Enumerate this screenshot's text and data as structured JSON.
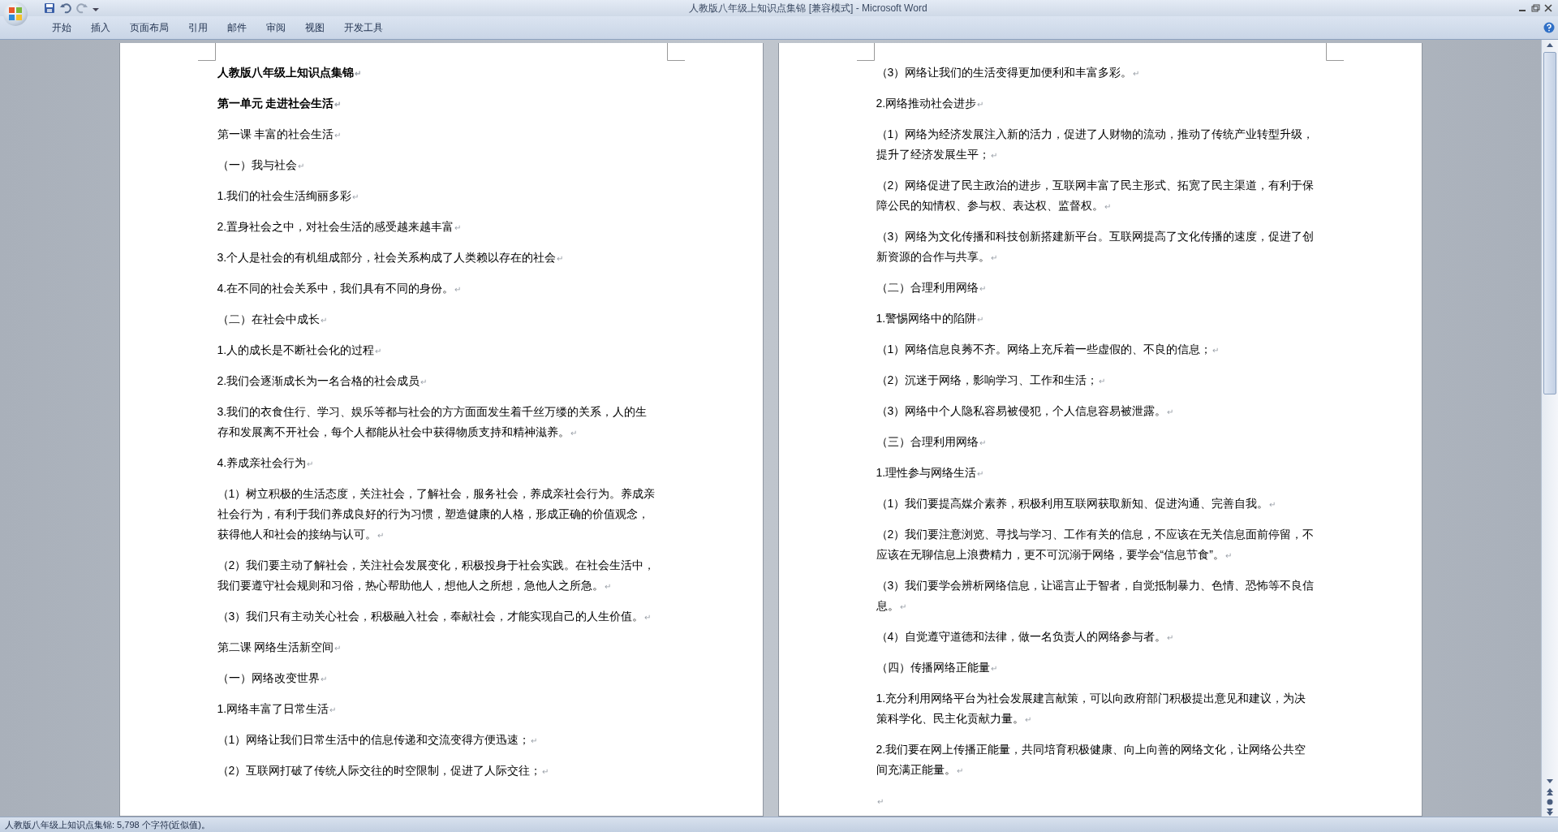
{
  "window": {
    "title": "人教版八年级上知识点集锦 [兼容模式] - Microsoft Word"
  },
  "tabs": [
    {
      "label": "开始",
      "selected": false
    },
    {
      "label": "插入",
      "selected": false
    },
    {
      "label": "页面布局",
      "selected": false
    },
    {
      "label": "引用",
      "selected": false
    },
    {
      "label": "邮件",
      "selected": false
    },
    {
      "label": "审阅",
      "selected": false
    },
    {
      "label": "视图",
      "selected": false
    },
    {
      "label": "开发工具",
      "selected": false
    }
  ],
  "pages": [
    {
      "paragraphs": [
        {
          "kind": "heading",
          "text": "人教版八年级上知识点集锦",
          "mark": "↵"
        },
        {
          "kind": "heading",
          "text": "第一单元  走进社会生活",
          "mark": "↵"
        },
        {
          "kind": "body",
          "text": "第一课  丰富的社会生活",
          "mark": "↵"
        },
        {
          "kind": "body",
          "text": "（一）我与社会",
          "mark": "↵"
        },
        {
          "kind": "body",
          "text": "1.我们的社会生活绚丽多彩",
          "mark": "↵"
        },
        {
          "kind": "body",
          "text": "2.置身社会之中，对社会生活的感受越来越丰富",
          "mark": "↵"
        },
        {
          "kind": "body",
          "text": "3.个人是社会的有机组成部分，社会关系构成了人类赖以存在的社会",
          "mark": "↵"
        },
        {
          "kind": "body",
          "text": "4.在不同的社会关系中，我们具有不同的身份。",
          "mark": "↵"
        },
        {
          "kind": "body",
          "text": "（二）在社会中成长",
          "mark": "↵"
        },
        {
          "kind": "body",
          "text": "1.人的成长是不断社会化的过程",
          "mark": "↵"
        },
        {
          "kind": "body",
          "text": "2.我们会逐渐成长为一名合格的社会成员",
          "mark": "↵"
        },
        {
          "kind": "body",
          "text": "3.我们的衣食住行、学习、娱乐等都与社会的方方面面发生着千丝万缕的关系，人的生存和发展离不开社会，每个人都能从社会中获得物质支持和精神滋养。",
          "mark": "↵"
        },
        {
          "kind": "body",
          "text": "4.养成亲社会行为",
          "mark": "↵"
        },
        {
          "kind": "body",
          "text": "（1）树立积极的生活态度，关注社会，了解社会，服务社会，养成亲社会行为。养成亲社会行为，有利于我们养成良好的行为习惯，塑造健康的人格，形成正确的价值观念，获得他人和社会的接纳与认可。",
          "mark": "↵"
        },
        {
          "kind": "body",
          "text": "（2）我们要主动了解社会，关注社会发展变化，积极投身于社会实践。在社会生活中，我们要遵守社会规则和习俗，热心帮助他人，想他人之所想，急他人之所急。",
          "mark": "↵"
        },
        {
          "kind": "body",
          "text": "（3）我们只有主动关心社会，积极融入社会，奉献社会，才能实现自己的人生价值。",
          "mark": "↵"
        },
        {
          "kind": "body",
          "text": "第二课  网络生活新空间",
          "mark": "↵"
        },
        {
          "kind": "body",
          "text": "（一）网络改变世界",
          "mark": "↵"
        },
        {
          "kind": "body",
          "text": "1.网络丰富了日常生活",
          "mark": "↵"
        },
        {
          "kind": "body",
          "text": "（1）网络让我们日常生活中的信息传递和交流变得方便迅速；",
          "mark": "↵"
        },
        {
          "kind": "body",
          "text": "（2）互联网打破了传统人际交往的时空限制，促进了人际交往；",
          "mark": "↵"
        }
      ]
    },
    {
      "paragraphs": [
        {
          "kind": "body",
          "text": "（3）网络让我们的生活变得更加便利和丰富多彩。",
          "mark": "↵"
        },
        {
          "kind": "body",
          "text": "2.网络推动社会进步",
          "mark": "↵"
        },
        {
          "kind": "body",
          "text": "（1）网络为经济发展注入新的活力，促进了人财物的流动，推动了传统产业转型升级，提升了经济发展生平；",
          "mark": "↵"
        },
        {
          "kind": "body",
          "text": "（2）网络促进了民主政治的进步，互联网丰富了民主形式、拓宽了民主渠道，有利于保障公民的知情权、参与权、表达权、监督权。",
          "mark": "↵"
        },
        {
          "kind": "body",
          "text": "（3）网络为文化传播和科技创新搭建新平台。互联网提高了文化传播的速度，促进了创新资源的合作与共享。",
          "mark": "↵"
        },
        {
          "kind": "body",
          "text": "（二）合理利用网络",
          "mark": "↵"
        },
        {
          "kind": "body",
          "text": "1.警惕网络中的陷阱",
          "mark": "↵"
        },
        {
          "kind": "body",
          "text": "（1）网络信息良莠不齐。网络上充斥着一些虚假的、不良的信息；",
          "mark": "↵"
        },
        {
          "kind": "body",
          "text": "（2）沉迷于网络，影响学习、工作和生活；",
          "mark": "↵"
        },
        {
          "kind": "body",
          "text": "（3）网络中个人隐私容易被侵犯，个人信息容易被泄露。",
          "mark": "↵"
        },
        {
          "kind": "body",
          "text": "（三）合理利用网络",
          "mark": "↵"
        },
        {
          "kind": "body",
          "text": "1.理性参与网络生活",
          "mark": "↵"
        },
        {
          "kind": "body",
          "text": "（1）我们要提高媒介素养，积极利用互联网获取新知、促进沟通、完善自我。",
          "mark": "↵"
        },
        {
          "kind": "body",
          "text": "（2）我们要注意浏览、寻找与学习、工作有关的信息，不应该在无关信息面前停留，不应该在无聊信息上浪费精力，更不可沉溺于网络，要学会“信息节食”。",
          "mark": "↵"
        },
        {
          "kind": "body",
          "text": "（3）我们要学会辨析网络信息，让谣言止于智者，自觉抵制暴力、色情、恐怖等不良信息。",
          "mark": "↵"
        },
        {
          "kind": "body",
          "text": "（4）自觉遵守道德和法律，做一名负责人的网络参与者。",
          "mark": "↵"
        },
        {
          "kind": "body",
          "text": "（四）传播网络正能量",
          "mark": "↵"
        },
        {
          "kind": "body",
          "text": "1.充分利用网络平台为社会发展建言献策，可以向政府部门积极提出意见和建议，为决策科学化、民主化贡献力量。",
          "mark": "↵"
        },
        {
          "kind": "body",
          "text": "2.我们要在网上传播正能量，共同培育积极健康、向上向善的网络文化，让网络公共空间充满正能量。",
          "mark": "↵"
        },
        {
          "kind": "empty",
          "mark": "↵"
        }
      ]
    }
  ],
  "status_bar": {
    "text": "人教版八年级上知识点集锦: 5,798 个字符(近似值)。"
  }
}
